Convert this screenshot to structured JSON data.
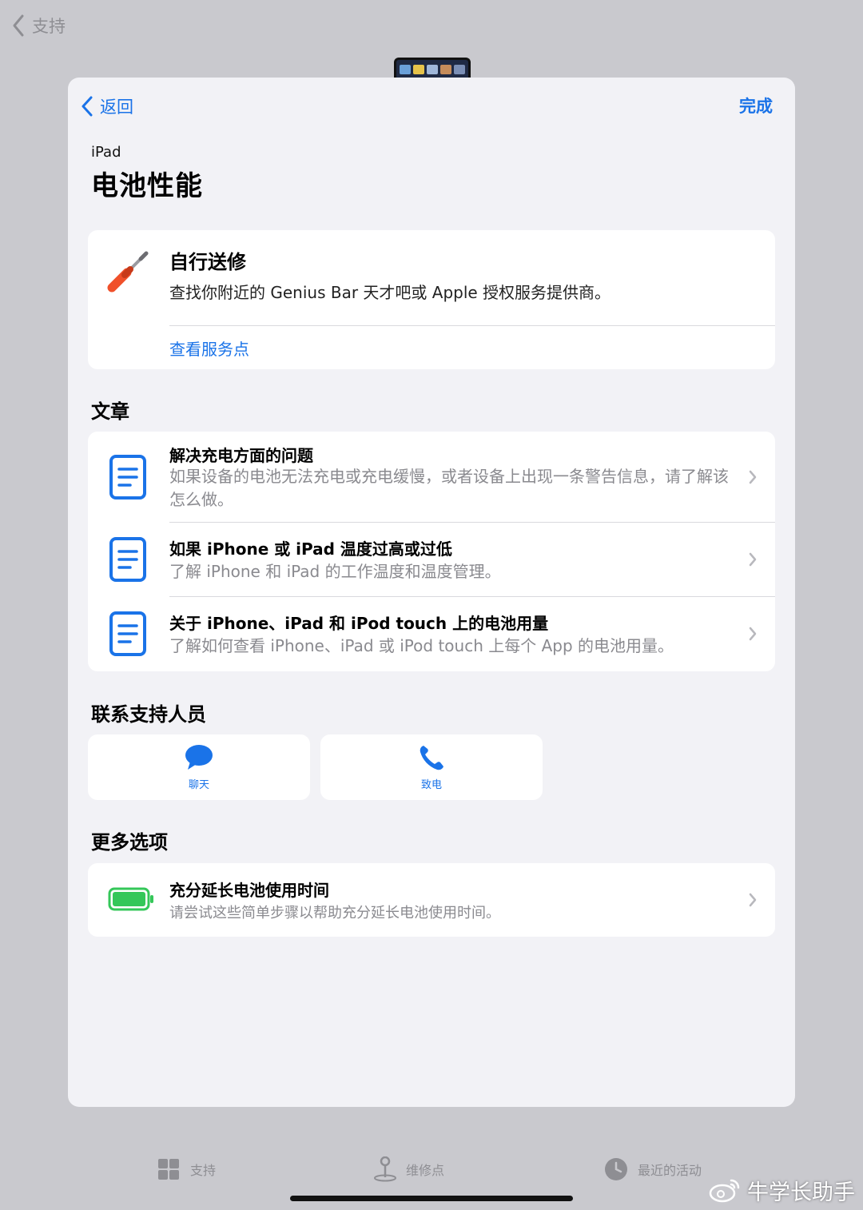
{
  "background": {
    "back_label": "支持"
  },
  "sheet": {
    "nav": {
      "back_label": "返回",
      "done_label": "完成"
    },
    "subtitle": "iPad",
    "title": "电池性能",
    "service": {
      "title": "自行送修",
      "description": "查找你附近的 Genius Bar 天才吧或 Apple 授权服务提供商。",
      "link": "查看服务点",
      "icon": "screwdriver-icon"
    },
    "articles": {
      "heading": "文章",
      "items": [
        {
          "title": "解决充电方面的问题",
          "description": "如果设备的电池无法充电或充电缓慢，或者设备上出现一条警告信息，请了解该怎么做。"
        },
        {
          "title": "如果 iPhone 或 iPad 温度过高或过低",
          "description": "了解 iPhone 和 iPad 的工作温度和温度管理。"
        },
        {
          "title": "关于 iPhone、iPad 和 iPod touch 上的电池用量",
          "description": "了解如何查看 iPhone、iPad 或 iPod touch 上每个 App 的电池用量。"
        }
      ]
    },
    "contact": {
      "heading": "联系支持人员",
      "chat_label": "聊天",
      "call_label": "致电"
    },
    "more": {
      "heading": "更多选项",
      "title": "充分延长电池使用时间",
      "description": "请尝试这些简单步骤以帮助充分延长电池使用时间。"
    }
  },
  "tabbar": {
    "support_label": "支持",
    "repair_label": "维修点",
    "recent_label": "最近的活动"
  },
  "watermark": {
    "text": "牛学长助手"
  },
  "colors": {
    "accent": "#1a73e8",
    "battery": "#34c759",
    "tool_handle": "#f0502a"
  }
}
